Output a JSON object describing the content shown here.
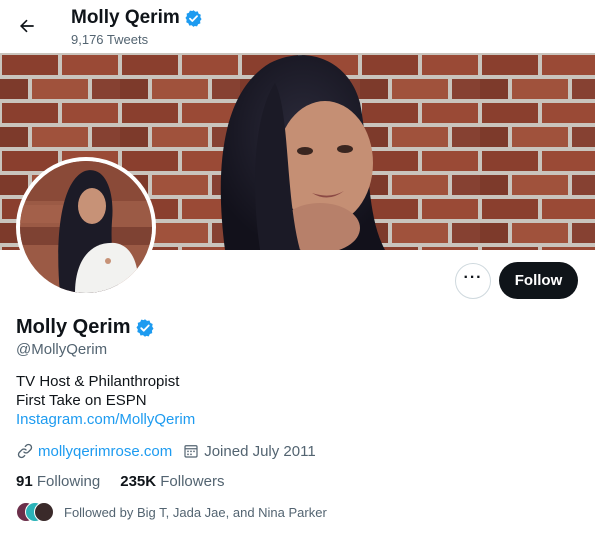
{
  "header": {
    "name": "Molly Qerim",
    "tweet_count": "9,176 Tweets"
  },
  "profile": {
    "name": "Molly Qerim",
    "handle": "@MollyQerim",
    "verified": true,
    "bio_lines": [
      "TV Host & Philanthropist",
      "First Take on ESPN"
    ],
    "bio_link": "Instagram.com/MollyQerim",
    "website": "mollyqerimrose.com",
    "joined": "Joined July 2011"
  },
  "actions": {
    "more_label": "···",
    "follow_label": "Follow"
  },
  "stats": {
    "following_count": "91",
    "following_label": "Following",
    "followers_count": "235K",
    "followers_label": "Followers"
  },
  "followed_by": "Followed by Big T, Jada Jae, and Nina Parker",
  "colors": {
    "accent": "#1d9bf0",
    "text": "#0f1419",
    "muted": "#536471",
    "follow_button": "#0f1419"
  },
  "icons": [
    "back-arrow-icon",
    "verified-badge-icon",
    "link-icon",
    "calendar-icon"
  ]
}
